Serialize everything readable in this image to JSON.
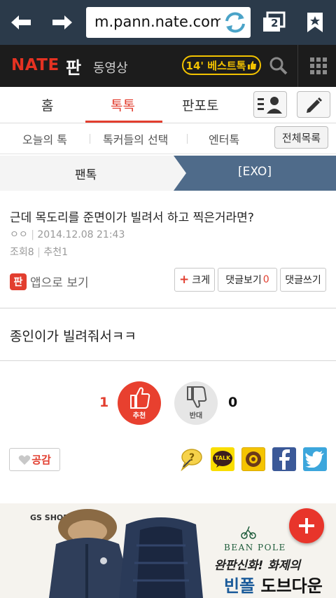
{
  "browser": {
    "url": "m.pann.nate.com/",
    "tab_count": "2"
  },
  "header": {
    "logo": "NATE",
    "pan": "판",
    "video": "동영상",
    "best_talk": "14' 베스트톡"
  },
  "main_tabs": {
    "home": "홈",
    "talk": "톡톡",
    "panphoto": "판포토"
  },
  "sub_tabs": {
    "today": "오늘의 톡",
    "talker_choice": "톡커들의 선택",
    "entertain": "엔터톡",
    "all_list": "전체목록"
  },
  "category": {
    "left": "팬톡",
    "right": "[EXO]"
  },
  "post": {
    "title": "근데 목도리를 준면이가 빌려서 하고 찍은거라면?",
    "author": "ㅇㅇ",
    "date": "2014.12.08 21:43",
    "views_label": "조회",
    "views": "8",
    "recommend_label": "추천",
    "recommend": "1",
    "app_icon": "판",
    "app_view": "앱으로 보기",
    "btn_big": "크게",
    "btn_comments": "댓글보기",
    "comments_count": "0",
    "btn_write_comment": "댓글쓰기",
    "body": "종인이가 빌려줘서ㅋㅋ"
  },
  "votes": {
    "up_count": "1",
    "up_label": "추천",
    "down_label": "반대",
    "down_count": "0"
  },
  "share": {
    "empathy": "공감",
    "kakao_label": "TALK"
  },
  "ad": {
    "shop": "GS SHOP",
    "brand": "BEAN POLE",
    "line1": "완판신화! 화제의",
    "line2_a": "빈폴",
    "line2_b": " 도브다운"
  },
  "colors": {
    "accent": "#e23e2f",
    "chrome": "#2b3a4a",
    "nate_bar": "#1c1c1c",
    "category_blue": "#4f6b8a"
  }
}
